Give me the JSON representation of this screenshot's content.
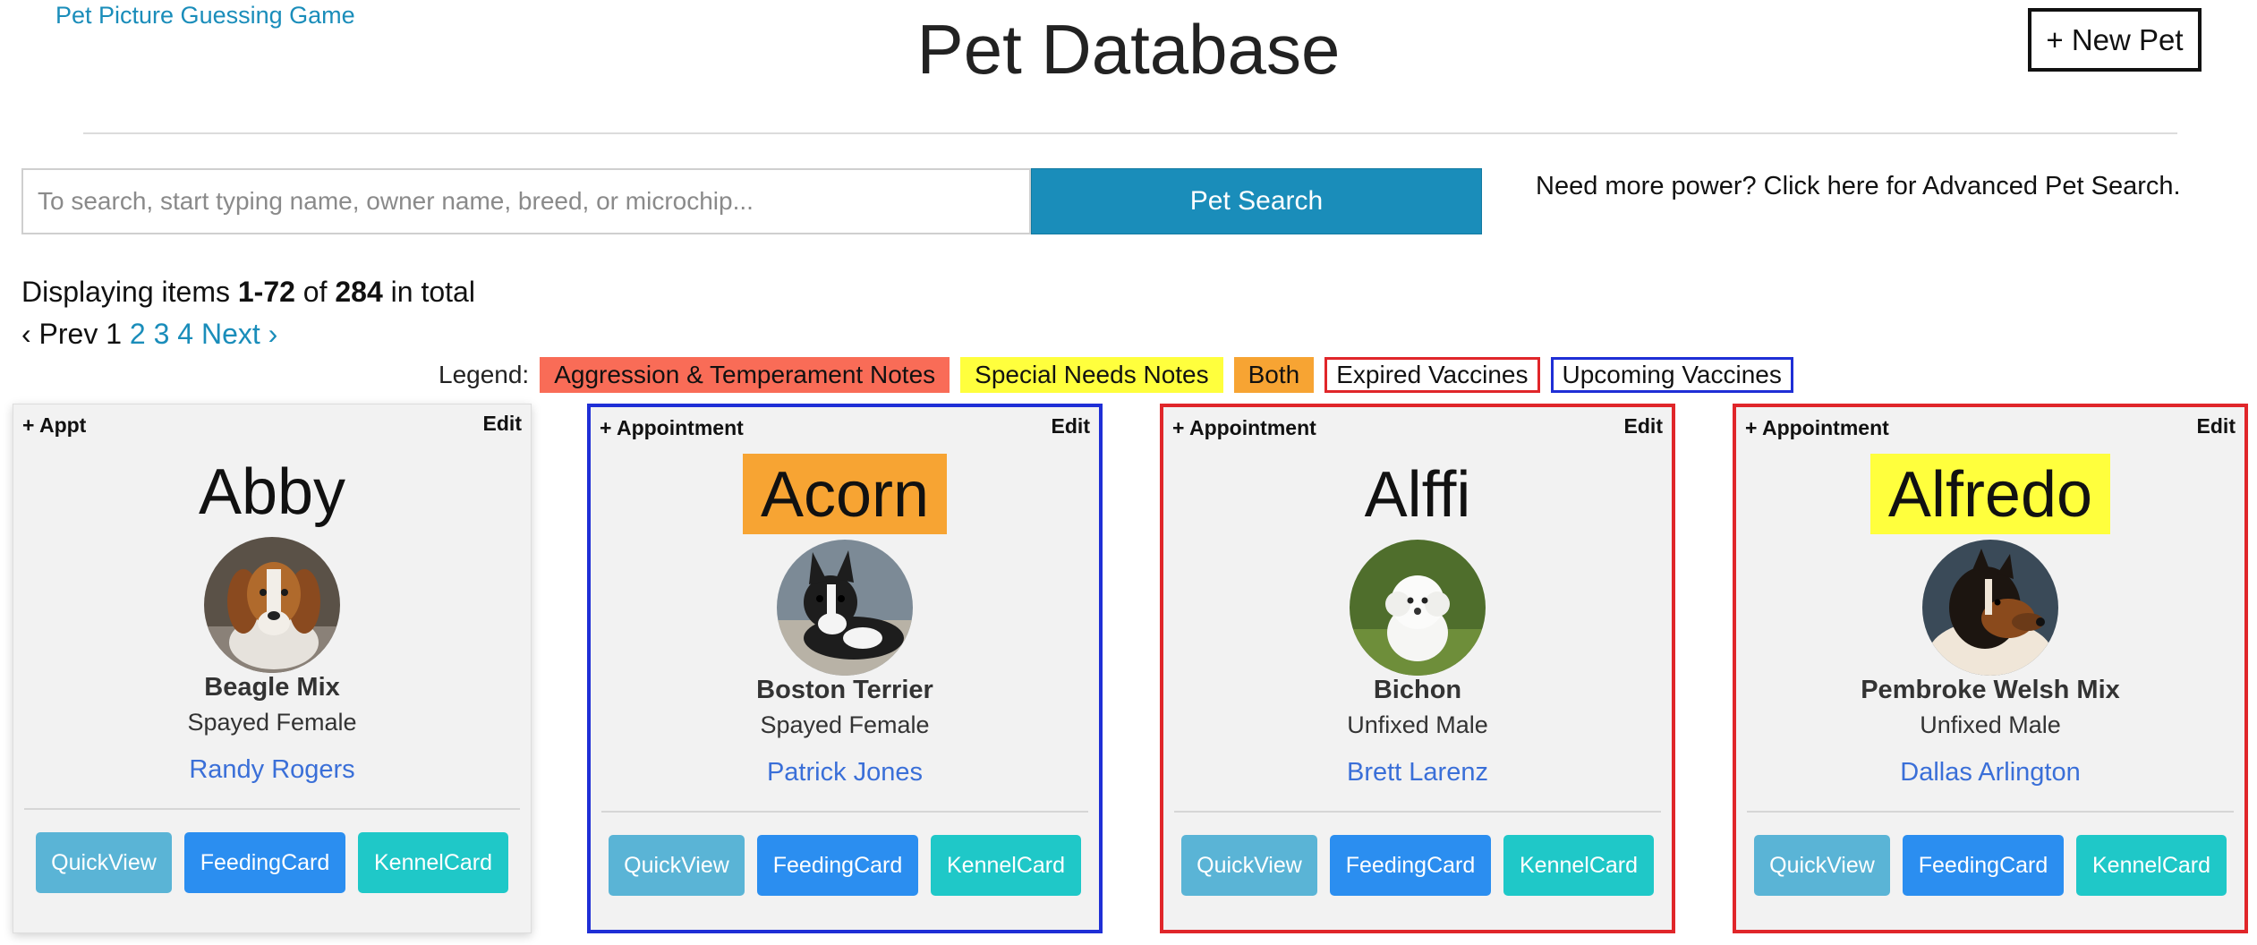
{
  "header": {
    "game_link": "Pet Picture Guessing Game",
    "title": "Pet Database",
    "new_pet": "+ New Pet"
  },
  "search": {
    "placeholder": "To search, start typing name, owner name, breed, or microchip...",
    "value": "",
    "button": "Pet Search",
    "advanced_link": "Need more power? Click here for Advanced Pet Search."
  },
  "results": {
    "prefix": "Displaying items",
    "range": "1-72",
    "of": "of",
    "total": "284",
    "suffix": "in total"
  },
  "pagination": {
    "prev": "‹ Prev",
    "current": "1",
    "pages": [
      "2",
      "3",
      "4"
    ],
    "next": "Next ›"
  },
  "legend": {
    "label": "Legend:",
    "aggression": "Aggression & Temperament Notes",
    "special": "Special Needs Notes",
    "both": "Both",
    "expired": "Expired Vaccines",
    "upcoming": "Upcoming Vaccines",
    "colors": {
      "aggression": "#f96c57",
      "special": "#ffff3d",
      "both": "#f7a433",
      "expired": "#e0262a",
      "upcoming": "#1f2fd6"
    }
  },
  "pets": [
    {
      "appt": "+ Appt",
      "edit": "Edit",
      "name": "Abby",
      "breed": "Beagle Mix",
      "sex": "Spayed Female",
      "owner": "Randy Rogers",
      "quickview": "QuickView",
      "feeding": "FeedingCard",
      "kennel": "KennelCard",
      "photo_icon": "beagle-photo"
    },
    {
      "appt": "+ Appointment",
      "edit": "Edit",
      "name": "Acorn",
      "breed": "Boston Terrier",
      "sex": "Spayed Female",
      "owner": "Patrick Jones",
      "quickview": "QuickView",
      "feeding": "FeedingCard",
      "kennel": "KennelCard",
      "photo_icon": "boston-terrier-photo"
    },
    {
      "appt": "+ Appointment",
      "edit": "Edit",
      "name": "Alffi",
      "breed": "Bichon",
      "sex": "Unfixed Male",
      "owner": "Brett Larenz",
      "quickview": "QuickView",
      "feeding": "FeedingCard",
      "kennel": "KennelCard",
      "photo_icon": "bichon-photo"
    },
    {
      "appt": "+ Appointment",
      "edit": "Edit",
      "name": "Alfredo",
      "breed": "Pembroke Welsh Mix",
      "sex": "Unfixed Male",
      "owner": "Dallas Arlington",
      "quickview": "QuickView",
      "feeding": "FeedingCard",
      "kennel": "KennelCard",
      "photo_icon": "collie-photo"
    }
  ]
}
